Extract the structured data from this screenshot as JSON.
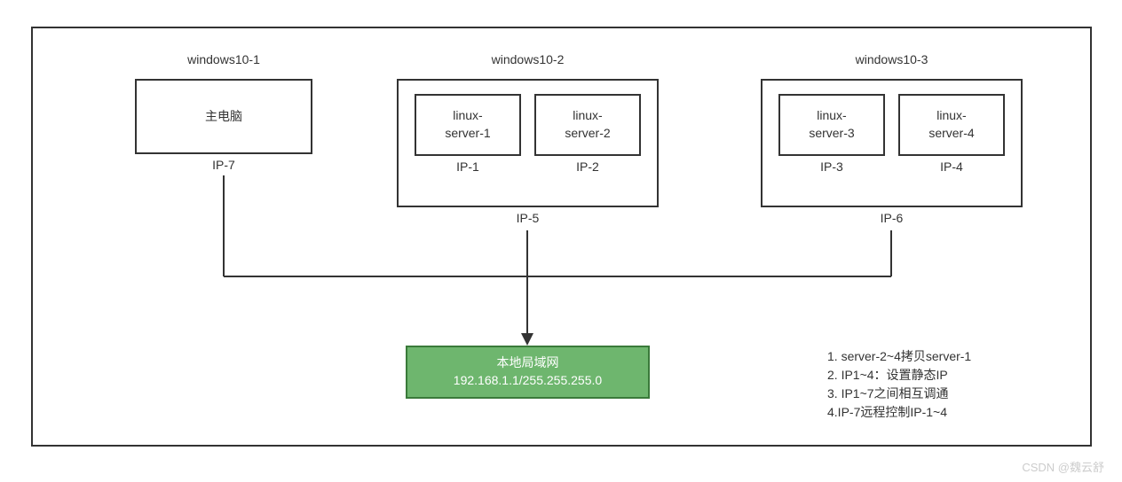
{
  "hosts": [
    {
      "title": "windows10-1",
      "ip": "IP-7"
    },
    {
      "title": "windows10-2",
      "ip": "IP-5"
    },
    {
      "title": "windows10-3",
      "ip": "IP-6"
    }
  ],
  "host1_box": "主电脑",
  "servers": [
    {
      "name": "linux-\nserver-1",
      "ip": "IP-1"
    },
    {
      "name": "linux-\nserver-2",
      "ip": "IP-2"
    },
    {
      "name": "linux-\nserver-3",
      "ip": "IP-3"
    },
    {
      "name": "linux-\nserver-4",
      "ip": "IP-4"
    }
  ],
  "lan": {
    "title": "本地局域网",
    "addr": "192.168.1.1/255.255.255.0"
  },
  "notes": [
    "1. server-2~4拷贝server-1",
    "2. IP1~4：设置静态IP",
    "3. IP1~7之间相互调通",
    "4.IP-7远程控制IP-1~4"
  ],
  "watermark": "CSDN @魏云舒"
}
